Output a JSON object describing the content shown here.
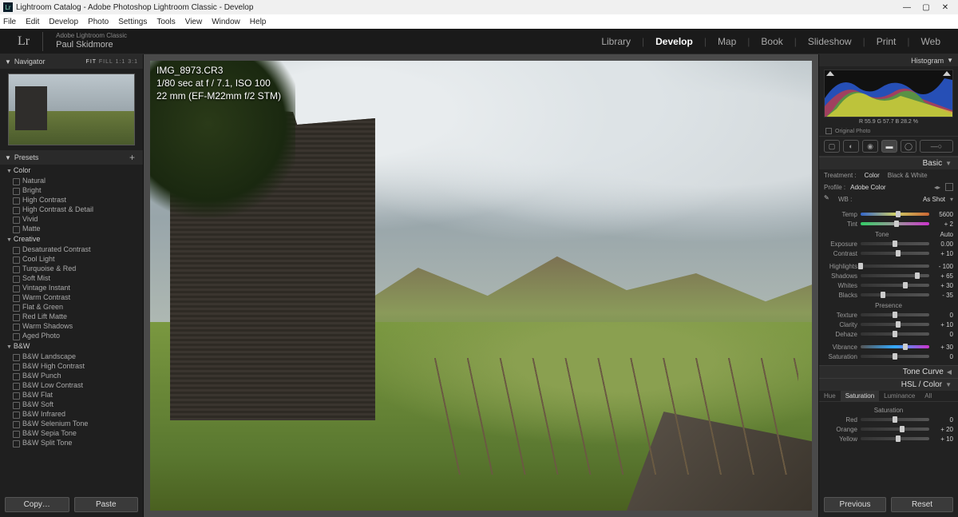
{
  "window": {
    "title": "Lightroom Catalog - Adobe Photoshop Lightroom Classic - Develop"
  },
  "menu": [
    "File",
    "Edit",
    "Develop",
    "Photo",
    "Settings",
    "Tools",
    "View",
    "Window",
    "Help"
  ],
  "brand": {
    "product": "Adobe Lightroom Classic",
    "user": "Paul Skidmore"
  },
  "modules": [
    "Library",
    "Develop",
    "Map",
    "Book",
    "Slideshow",
    "Print",
    "Web"
  ],
  "active_module": "Develop",
  "navigator": {
    "title": "Navigator",
    "modes": {
      "fit": "FIT",
      "fill": "FILL",
      "one": "1:1",
      "ratio": "3:1"
    }
  },
  "presets": {
    "title": "Presets",
    "groups": [
      {
        "name": "Color",
        "items": [
          "Natural",
          "Bright",
          "High Contrast",
          "High Contrast & Detail",
          "Vivid",
          "Matte"
        ]
      },
      {
        "name": "Creative",
        "items": [
          "Desaturated Contrast",
          "Cool Light",
          "Turquoise & Red",
          "Soft Mist",
          "Vintage Instant",
          "Warm Contrast",
          "Flat & Green",
          "Red Lift Matte",
          "Warm Shadows",
          "Aged Photo"
        ]
      },
      {
        "name": "B&W",
        "items": [
          "B&W Landscape",
          "B&W High Contrast",
          "B&W Punch",
          "B&W Low Contrast",
          "B&W Flat",
          "B&W Soft",
          "B&W Infrared",
          "B&W Selenium Tone",
          "B&W Sepia Tone",
          "B&W Split Tone"
        ]
      }
    ]
  },
  "left_buttons": {
    "copy": "Copy…",
    "paste": "Paste"
  },
  "photo_overlay": {
    "filename": "IMG_8973.CR3",
    "line2": "1/80 sec at f / 7.1, ISO 100",
    "line3": "22 mm (EF-M22mm f/2 STM)"
  },
  "histogram": {
    "title": "Histogram",
    "readout": "R  55.9   G  57.7   B  28.2  %",
    "original_label": "Original Photo"
  },
  "basic": {
    "title": "Basic",
    "treatment_label": "Treatment :",
    "treatment_color": "Color",
    "treatment_bw": "Black & White",
    "profile_label": "Profile :",
    "profile_value": "Adobe Color",
    "wb_label": "WB :",
    "wb_value": "As Shot",
    "tone_label": "Tone",
    "auto_label": "Auto",
    "presence_label": "Presence",
    "sliders": {
      "temp": {
        "label": "Temp",
        "value": "5600",
        "pos": 55
      },
      "tint": {
        "label": "Tint",
        "value": "+ 2",
        "pos": 52
      },
      "exposure": {
        "label": "Exposure",
        "value": "0.00",
        "pos": 50
      },
      "contrast": {
        "label": "Contrast",
        "value": "+ 10",
        "pos": 55
      },
      "highlights": {
        "label": "Highlights",
        "value": "- 100",
        "pos": 0
      },
      "shadows": {
        "label": "Shadows",
        "value": "+ 65",
        "pos": 82
      },
      "whites": {
        "label": "Whites",
        "value": "+ 30",
        "pos": 65
      },
      "blacks": {
        "label": "Blacks",
        "value": "- 35",
        "pos": 33
      },
      "texture": {
        "label": "Texture",
        "value": "0",
        "pos": 50
      },
      "clarity": {
        "label": "Clarity",
        "value": "+ 10",
        "pos": 55
      },
      "dehaze": {
        "label": "Dehaze",
        "value": "0",
        "pos": 50
      },
      "vibrance": {
        "label": "Vibrance",
        "value": "+ 30",
        "pos": 65
      },
      "saturation": {
        "label": "Saturation",
        "value": "0",
        "pos": 50
      }
    }
  },
  "tone_curve": {
    "title": "Tone Curve"
  },
  "hsl": {
    "title": "HSL / Color",
    "tabs": [
      "Hue",
      "Saturation",
      "Luminance",
      "All"
    ],
    "active_tab": "Saturation",
    "sub_label": "Saturation",
    "sliders": {
      "red": {
        "label": "Red",
        "value": "0",
        "pos": 50
      },
      "orange": {
        "label": "Orange",
        "value": "+ 20",
        "pos": 60
      },
      "yellow": {
        "label": "Yellow",
        "value": "+ 10",
        "pos": 55
      }
    }
  },
  "right_buttons": {
    "previous": "Previous",
    "reset": "Reset"
  }
}
